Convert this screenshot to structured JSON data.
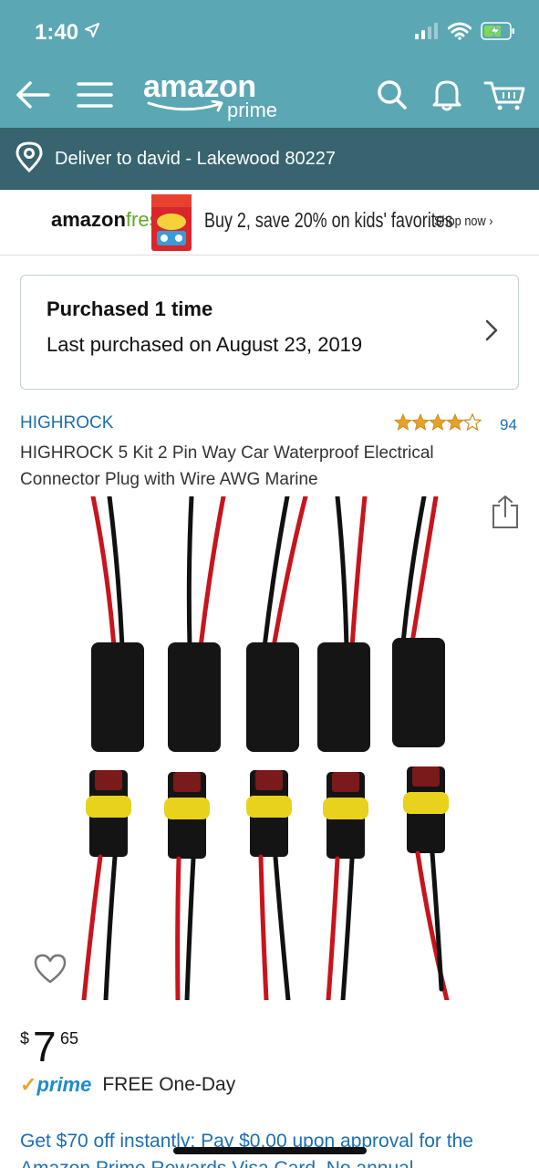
{
  "status_bar": {
    "time": "1:40"
  },
  "nav": {
    "logo_word": "amazon",
    "logo_sub": "prime"
  },
  "deliver": {
    "text": "Deliver to david - Lakewood 80227"
  },
  "banner": {
    "brand_part1": "amazon",
    "brand_part2": "fresh",
    "offer": "Buy 2, save 20% on kids' favorites",
    "cta": "Shop now ›"
  },
  "purchase": {
    "title": "Purchased 1 time",
    "date": "Last purchased on August 23, 2019"
  },
  "product": {
    "brand": "HIGHROCK",
    "rating": 4.5,
    "rating_count": "94",
    "title": "HIGHROCK 5 Kit 2 Pin Way Car Waterproof Electrical Connector Plug with Wire AWG Marine"
  },
  "price": {
    "symbol": "$",
    "whole": "7",
    "fraction": "65"
  },
  "shipping": {
    "prime_label": "prime",
    "text": "FREE One-Day"
  },
  "promo": {
    "text": "Get $70 off instantly: Pay $0.00 upon approval for the Amazon Prime Rewards Visa Card. No annual"
  },
  "colors": {
    "header": "#5ba7b4",
    "deliver_bar": "#37646e",
    "link": "#1c6fb3",
    "star": "#e5a128",
    "prime_blue": "#1c8ccf"
  }
}
